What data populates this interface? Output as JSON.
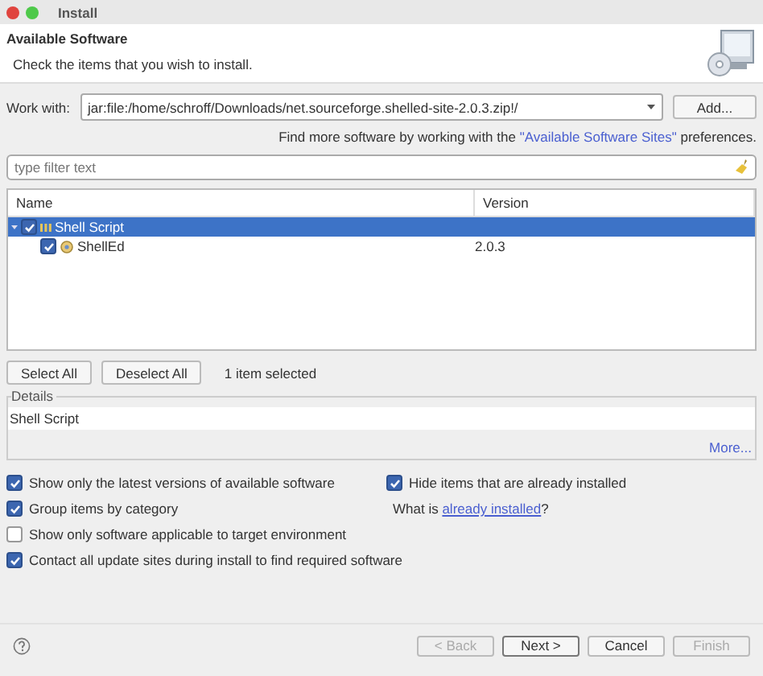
{
  "window": {
    "title": "Install"
  },
  "header": {
    "title": "Available Software",
    "subtitle": "Check the items that you wish to install."
  },
  "work_with": {
    "label": "Work with:",
    "value": "jar:file:/home/schroff/Downloads/net.sourceforge.shelled-site-2.0.3.zip!/",
    "add_button": "Add..."
  },
  "find_more": {
    "before": "Find more software by working with the ",
    "link": "\"Available Software Sites\"",
    "after": " preferences."
  },
  "filter": {
    "placeholder": "type filter text"
  },
  "tree": {
    "columns": [
      "Name",
      "Version"
    ],
    "rows": [
      {
        "name": "Shell Script",
        "version": "",
        "checked": true,
        "selected": true,
        "expanded": true,
        "kind": "category",
        "children": [
          {
            "name": "ShellEd",
            "version": "2.0.3",
            "checked": true,
            "selected": false,
            "kind": "feature"
          }
        ]
      }
    ]
  },
  "selection": {
    "buttons": [
      "Select All",
      "Deselect All"
    ],
    "status": "1 item selected"
  },
  "details": {
    "title": "Details",
    "text": "Shell Script",
    "more": "More..."
  },
  "options": [
    {
      "label": "Show only the latest versions of available software",
      "checked": true
    },
    {
      "label": "Group items by category",
      "checked": true
    },
    {
      "label": "Show only software applicable to target environment",
      "checked": false
    },
    {
      "label": "Contact all update sites during install to find required software",
      "checked": true
    }
  ],
  "side_options": [
    {
      "label": "Hide items that are already installed",
      "checked": true
    }
  ],
  "already_installed": {
    "before": "What is ",
    "link": "already installed",
    "after": "?"
  },
  "footer": {
    "buttons": [
      {
        "label": "< Back",
        "disabled": true,
        "default": false
      },
      {
        "label": "Next >",
        "disabled": false,
        "default": true
      },
      {
        "label": "Cancel",
        "disabled": false,
        "default": false
      },
      {
        "label": "Finish",
        "disabled": true,
        "default": false
      }
    ]
  }
}
